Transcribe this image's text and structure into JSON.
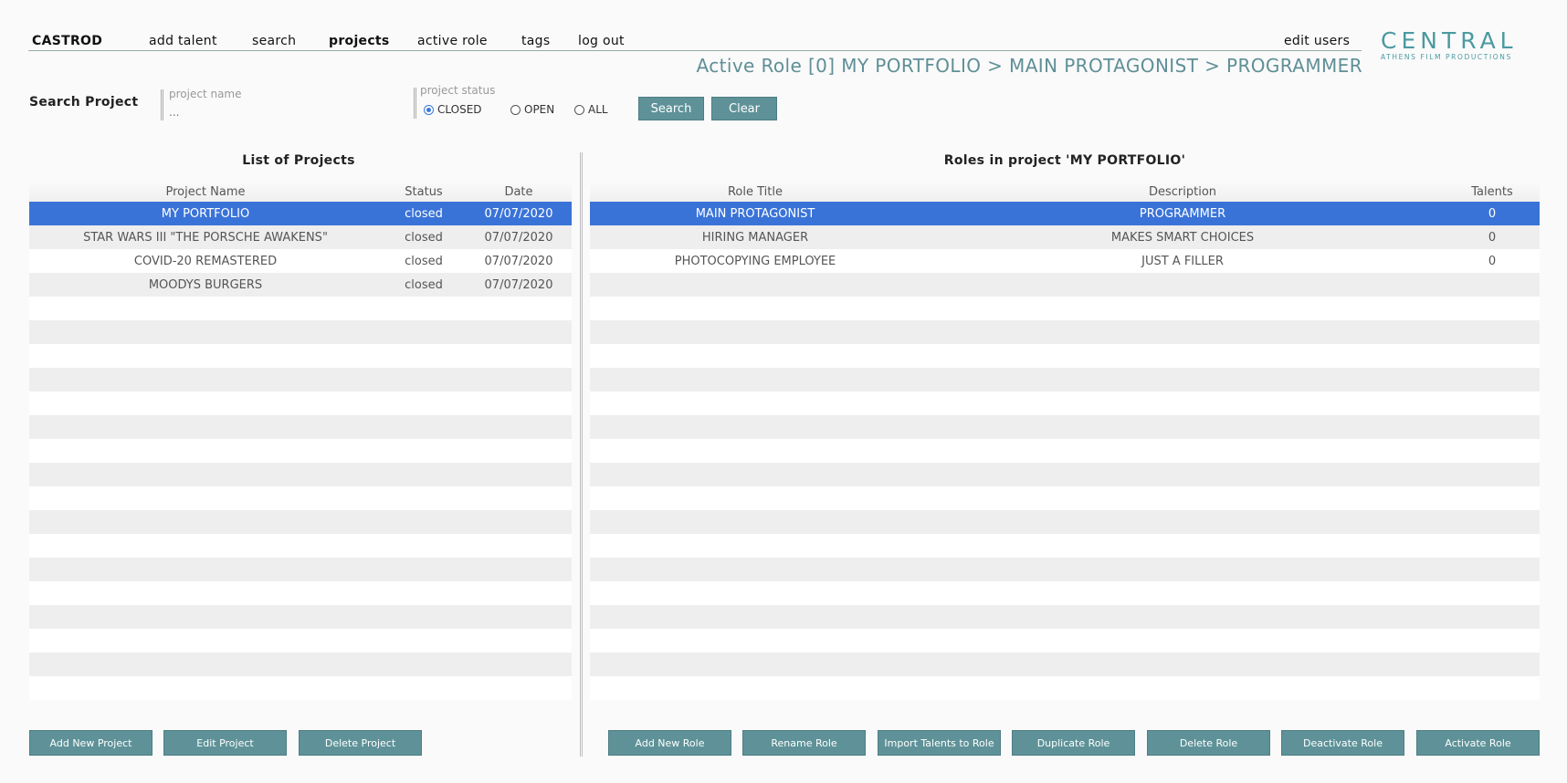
{
  "nav": {
    "brand": "CASTROD",
    "items": [
      "add talent",
      "search",
      "projects",
      "active role",
      "tags",
      "log out"
    ],
    "edit_users": "edit users"
  },
  "logo": {
    "main": "CENTRAL",
    "sub": "ATHENS FILM PRODUCTIONS"
  },
  "active_role": "Active Role [0] MY PORTFOLIO > MAIN PROTAGONIST > PROGRAMMER",
  "search": {
    "label": "Search Project",
    "name_label": "project name",
    "name_placeholder": "...",
    "status_label": "project status",
    "status_options": [
      "CLOSED",
      "OPEN",
      "ALL"
    ],
    "selected_status": "CLOSED",
    "search_button": "Search",
    "clear_button": "Clear"
  },
  "projects": {
    "title": "List of Projects",
    "columns": [
      "Project Name",
      "Status",
      "Date"
    ],
    "rows": [
      [
        "MY PORTFOLIO",
        "closed",
        "07/07/2020"
      ],
      [
        "STAR WARS III \"THE PORSCHE AWAKENS\"",
        "closed",
        "07/07/2020"
      ],
      [
        "COVID-20 REMASTERED",
        "closed",
        "07/07/2020"
      ],
      [
        "MOODYS BURGERS",
        "closed",
        "07/07/2020"
      ]
    ],
    "selected_index": 0,
    "buttons": [
      "Add New Project",
      "Edit Project",
      "Delete Project"
    ]
  },
  "roles": {
    "title": "Roles in project 'MY PORTFOLIO'",
    "columns": [
      "Role Title",
      "Description",
      "Talents"
    ],
    "rows": [
      [
        "MAIN PROTAGONIST",
        "PROGRAMMER",
        "0"
      ],
      [
        "HIRING MANAGER",
        "MAKES SMART CHOICES",
        "0"
      ],
      [
        "PHOTOCOPYING EMPLOYEE",
        "JUST A FILLER",
        "0"
      ]
    ],
    "selected_index": 0,
    "buttons": [
      "Add New Role",
      "Rename Role",
      "Import Talents to Role",
      "Duplicate Role",
      "Delete Role",
      "Deactivate Role",
      "Activate Role"
    ]
  },
  "colors": {
    "accent": "#5e9298",
    "selected": "#3a73d8",
    "logo": "#4a9aa0"
  }
}
